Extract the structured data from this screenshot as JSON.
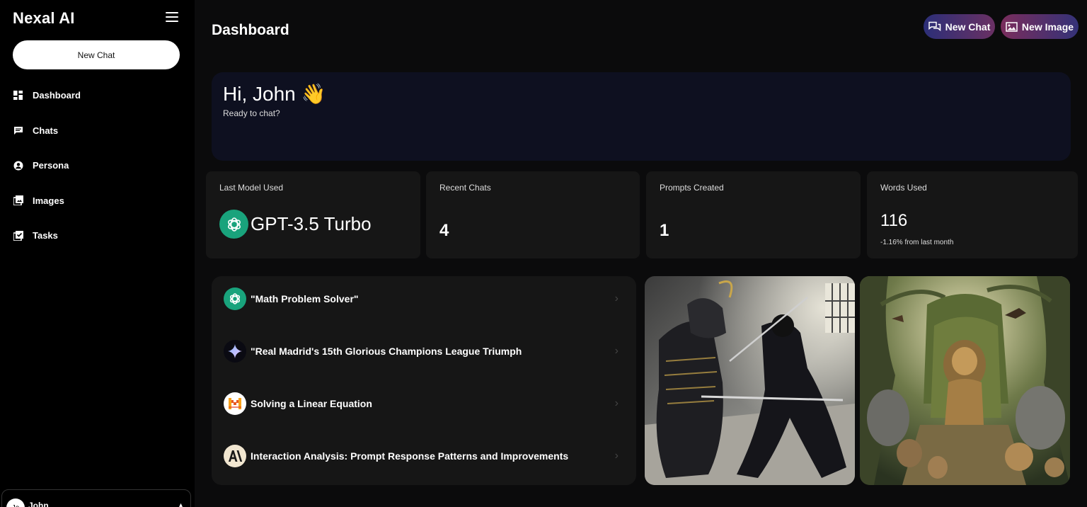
{
  "app": {
    "title": "Nexal AI"
  },
  "sidebar": {
    "new_chat_label": "New Chat",
    "items": [
      {
        "label": "Dashboard",
        "icon": "grid-icon"
      },
      {
        "label": "Chats",
        "icon": "chat-icon"
      },
      {
        "label": "Persona",
        "icon": "person-icon"
      },
      {
        "label": "Images",
        "icon": "images-icon"
      },
      {
        "label": "Tasks",
        "icon": "tasks-icon"
      }
    ],
    "user": {
      "name": "John",
      "initials": "Jo"
    }
  },
  "header": {
    "title": "Dashboard",
    "new_chat_label": "New Chat",
    "new_image_label": "New Image"
  },
  "hero": {
    "greeting": "Hi, John 👋",
    "subtitle": "Ready to chat?"
  },
  "stats": {
    "last_model": {
      "label": "Last Model Used",
      "value": "GPT-3.5 Turbo"
    },
    "recent_chats": {
      "label": "Recent Chats",
      "value": "4"
    },
    "prompts_created": {
      "label": "Prompts Created",
      "value": "1"
    },
    "words_used": {
      "label": "Words Used",
      "value": "116",
      "change": "-1.16% from last month"
    }
  },
  "recent_chats": [
    {
      "title": "\"Math Problem Solver\"",
      "icon": "openai-icon"
    },
    {
      "title": "\"Real Madrid's 15th Glorious Champions League Triumph",
      "icon": "gemini-icon"
    },
    {
      "title": "Solving a Linear Equation",
      "icon": "mistral-icon"
    },
    {
      "title": "Interaction Analysis: Prompt Response Patterns and Improvements",
      "icon": "anthropic-icon"
    }
  ],
  "gallery": [
    {
      "subject": "samurai-vs-ninja"
    },
    {
      "subject": "lion-on-throne"
    }
  ],
  "colors": {
    "background": "#0b0b0c",
    "sidebar": "#000000",
    "card": "#161616",
    "hero": "#0e1020",
    "openai_green": "#19a37c"
  }
}
